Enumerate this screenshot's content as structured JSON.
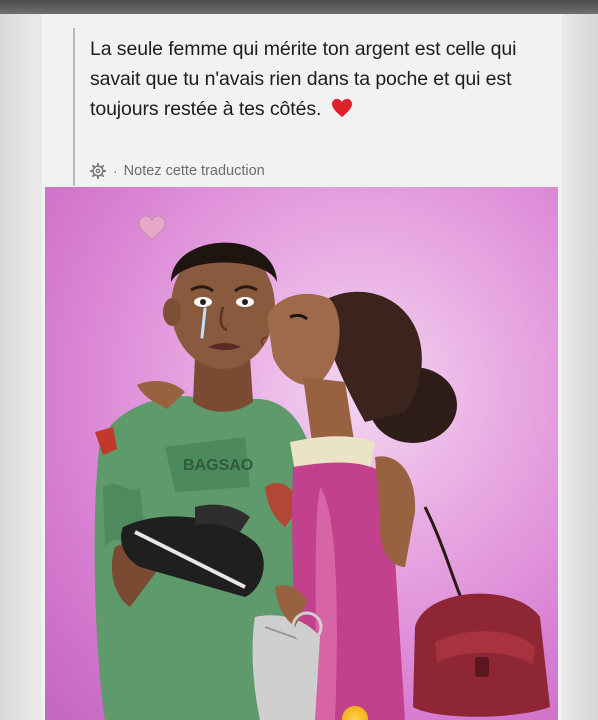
{
  "post": {
    "text": "La seule femme qui mérite ton argent est celle qui savait que tu n'avais rien dans ta poche et qui est toujours restée à tes côtés.",
    "emoji": "red-heart",
    "translation_link": "Notez cette traduction",
    "separator": "·"
  },
  "illustration": {
    "shirt_text": "BAGSAO",
    "colors": {
      "background_pink": "#d77dd1",
      "shirt_green": "#5e9a6c",
      "dress_magenta": "#c2418c",
      "bag_red": "#8e2634",
      "heart_red": "#e0202b"
    }
  },
  "icons": {
    "settings": "gear-icon",
    "heart": "heart-icon"
  }
}
